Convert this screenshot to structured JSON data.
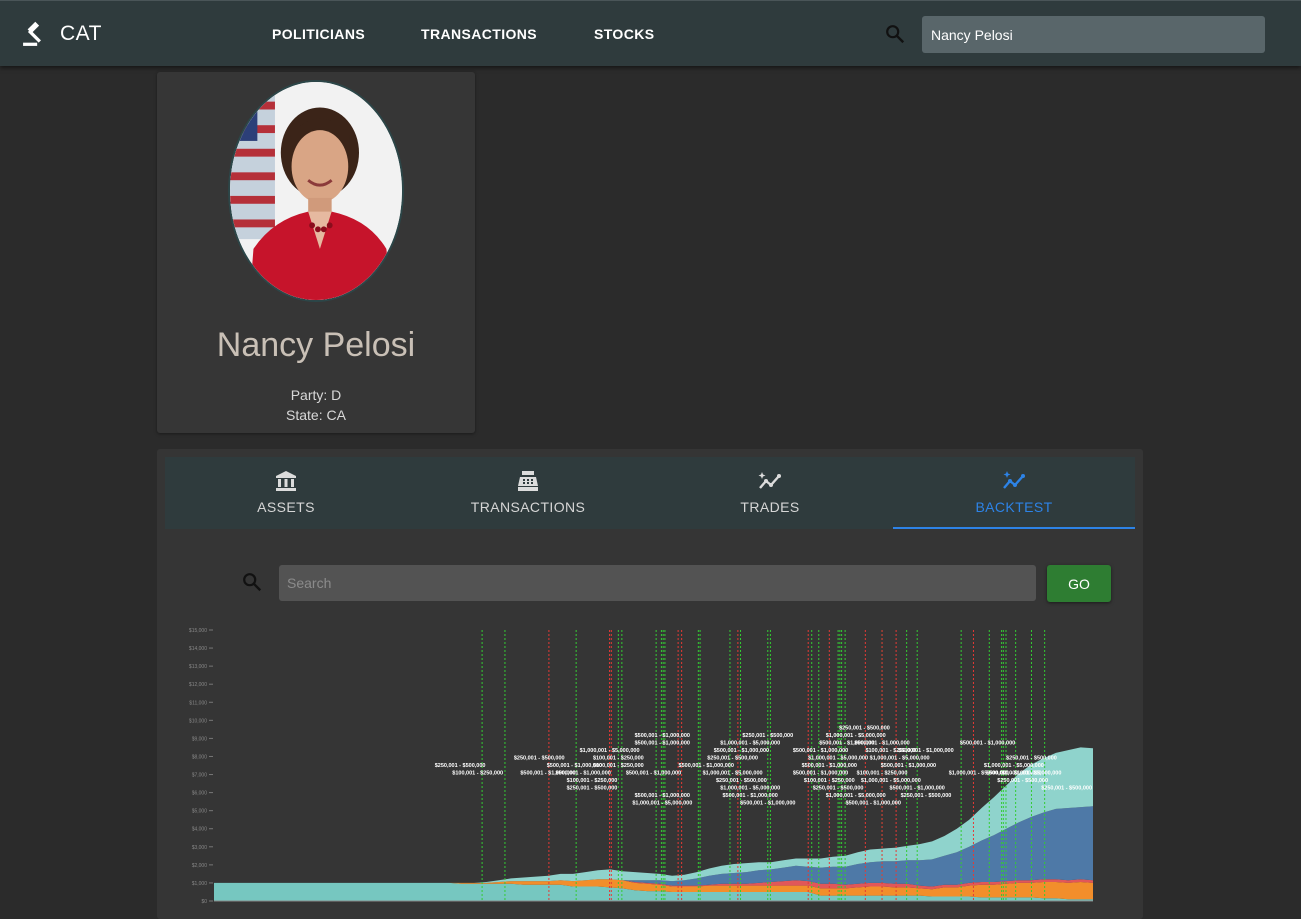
{
  "app": {
    "title": "CAT"
  },
  "nav": {
    "politicians": "POLITICIANS",
    "transactions": "TRANSACTIONS",
    "stocks": "STOCKS"
  },
  "search": {
    "value": "Nancy Pelosi"
  },
  "politician": {
    "name": "Nancy Pelosi",
    "party": "Party: D",
    "state": "State: CA"
  },
  "tabs": [
    {
      "label": "ASSETS",
      "icon": "bank-icon"
    },
    {
      "label": "TRANSACTIONS",
      "icon": "cash-register-icon"
    },
    {
      "label": "TRADES",
      "icon": "chart-line-icon"
    },
    {
      "label": "BACKTEST",
      "icon": "chart-sparkle-icon",
      "active": true
    }
  ],
  "backtest": {
    "search_placeholder": "Search",
    "go_label": "GO"
  },
  "colors": {
    "accent": "#2d83e6",
    "go": "#2e7d32",
    "teal": "#76c7c0",
    "orange": "#f28e2b",
    "red": "#e15759",
    "blue": "#4e79a7",
    "buy_line": "#33cc33",
    "sell_line": "#e53935"
  },
  "chart_data": {
    "type": "area",
    "stacked": true,
    "series": [
      {
        "color": "#76c7c0",
        "values": [
          1000,
          1000,
          1000,
          1000,
          1000,
          1000,
          1000,
          1000,
          1000,
          1000,
          1000,
          1000,
          1000,
          1000,
          1000,
          1000,
          1000,
          1000,
          1000,
          1000,
          950,
          950,
          950,
          950,
          950,
          900,
          900,
          900,
          900,
          800,
          800,
          800,
          750,
          700,
          600,
          550,
          550,
          500,
          500,
          500,
          500,
          500,
          500,
          500,
          500,
          500,
          500,
          500,
          500,
          300,
          300,
          300,
          300,
          300,
          300,
          300,
          300,
          300,
          250,
          250,
          250,
          250,
          200,
          200,
          200,
          200,
          200,
          150,
          150,
          100,
          100,
          100
        ]
      },
      {
        "color": "#f28e2b",
        "values": [
          0,
          0,
          0,
          0,
          0,
          0,
          0,
          0,
          0,
          0,
          0,
          0,
          0,
          0,
          0,
          0,
          0,
          0,
          0,
          0,
          50,
          50,
          50,
          100,
          150,
          200,
          200,
          200,
          250,
          300,
          350,
          400,
          450,
          450,
          400,
          400,
          350,
          300,
          300,
          300,
          350,
          350,
          350,
          350,
          350,
          350,
          350,
          350,
          350,
          400,
          400,
          400,
          450,
          500,
          500,
          450,
          450,
          400,
          400,
          500,
          500,
          600,
          700,
          700,
          750,
          800,
          800,
          900,
          900,
          900,
          950,
          900
        ]
      },
      {
        "color": "#e15759",
        "values": [
          0,
          0,
          0,
          0,
          0,
          0,
          0,
          0,
          0,
          0,
          0,
          0,
          0,
          0,
          0,
          0,
          0,
          0,
          0,
          0,
          0,
          0,
          0,
          0,
          0,
          0,
          0,
          0,
          0,
          0,
          0,
          0,
          0,
          0,
          50,
          50,
          50,
          50,
          50,
          50,
          50,
          100,
          100,
          100,
          150,
          200,
          250,
          300,
          250,
          250,
          250,
          200,
          200,
          200,
          200,
          200,
          200,
          150,
          150,
          150,
          150,
          150,
          150,
          150,
          150,
          150,
          150,
          150,
          150,
          150,
          150,
          150
        ]
      },
      {
        "color": "#4e79a7",
        "values": [
          0,
          0,
          0,
          0,
          0,
          0,
          0,
          0,
          0,
          0,
          0,
          0,
          0,
          0,
          0,
          0,
          0,
          0,
          0,
          0,
          0,
          0,
          0,
          0,
          0,
          0,
          0,
          0,
          0,
          0,
          0,
          0,
          0,
          0,
          100,
          150,
          200,
          250,
          300,
          400,
          500,
          550,
          600,
          650,
          700,
          700,
          750,
          800,
          800,
          900,
          950,
          1000,
          1100,
          1150,
          1200,
          1250,
          1300,
          1400,
          1500,
          1600,
          1800,
          2000,
          2300,
          2600,
          2900,
          3200,
          3500,
          3700,
          3900,
          4000,
          4000,
          4100
        ]
      },
      {
        "color": "#8fd3cc",
        "values": [
          0,
          0,
          0,
          0,
          0,
          0,
          0,
          0,
          0,
          0,
          0,
          0,
          0,
          0,
          0,
          0,
          0,
          0,
          0,
          0,
          0,
          0,
          50,
          100,
          150,
          200,
          250,
          300,
          350,
          400,
          450,
          500,
          550,
          500,
          450,
          400,
          350,
          300,
          300,
          350,
          400,
          450,
          500,
          500,
          450,
          400,
          400,
          400,
          450,
          500,
          550,
          600,
          650,
          700,
          700,
          750,
          800,
          900,
          1000,
          1100,
          1300,
          1500,
          1800,
          2100,
          2400,
          2700,
          2900,
          3000,
          3100,
          3200,
          3300,
          3200
        ]
      }
    ],
    "y_ticks": [
      "$0",
      "$1,000",
      "$2,000",
      "$3,000",
      "$4,000",
      "$5,000",
      "$6,000",
      "$7,000",
      "$8,000",
      "$9,000",
      "$10,000",
      "$11,000",
      "$12,000",
      "$13,000",
      "$14,000",
      "$15,000"
    ],
    "ylim": [
      0,
      15000
    ],
    "buy_lines": [
      0.305,
      0.331,
      0.412,
      0.46,
      0.464,
      0.503,
      0.509,
      0.511,
      0.513,
      0.551,
      0.553,
      0.587,
      0.599,
      0.63,
      0.633,
      0.68,
      0.688,
      0.71,
      0.712,
      0.714,
      0.718,
      0.76,
      0.788,
      0.8,
      0.85,
      0.882,
      0.896,
      0.898,
      0.901,
      0.912,
      0.93,
      0.945
    ],
    "sell_lines": [
      0.381,
      0.45,
      0.452,
      0.528,
      0.532,
      0.596,
      0.676,
      0.7,
      0.741,
      0.76,
      0.776,
      0.864
    ],
    "annotations": [
      {
        "text": "$500,001 - $1,000,000",
        "x": 0.51,
        "row": 0
      },
      {
        "text": "$500,001 - $1,000,000",
        "x": 0.51,
        "row": 1
      },
      {
        "text": "$1,000,001 - $5,000,000",
        "x": 0.45,
        "row": 2
      },
      {
        "text": "$250,001 - $500,000",
        "x": 0.37,
        "row": 3
      },
      {
        "text": "$100,001 - $250,000",
        "x": 0.46,
        "row": 3
      },
      {
        "text": "$500,001 - $1,000,000",
        "x": 0.41,
        "row": 4
      },
      {
        "text": "$100,001 - $250,000",
        "x": 0.46,
        "row": 4
      },
      {
        "text": "$250,001 - $500,000",
        "x": 0.28,
        "row": 4
      },
      {
        "text": "$100,001 - $250,000",
        "x": 0.3,
        "row": 5
      },
      {
        "text": "$500,001 - $1,000,000",
        "x": 0.38,
        "row": 5
      },
      {
        "text": "$500,001 - $1,000,000",
        "x": 0.42,
        "row": 5
      },
      {
        "text": "$500,001 - $1,000,000",
        "x": 0.5,
        "row": 5
      },
      {
        "text": "$100,001 - $250,000",
        "x": 0.43,
        "row": 6
      },
      {
        "text": "$250,001 - $500,000",
        "x": 0.43,
        "row": 7
      },
      {
        "text": "$500,001 - $1,000,000",
        "x": 0.51,
        "row": 8
      },
      {
        "text": "$1,000,001 - $5,000,000",
        "x": 0.51,
        "row": 9
      },
      {
        "text": "$250,001 - $500,000",
        "x": 0.63,
        "row": 0
      },
      {
        "text": "$1,000,001 - $5,000,000",
        "x": 0.61,
        "row": 1
      },
      {
        "text": "$500,001 - $1,000,000",
        "x": 0.6,
        "row": 2
      },
      {
        "text": "$250,001 - $500,000",
        "x": 0.59,
        "row": 3
      },
      {
        "text": "$500,001 - $1,000,000",
        "x": 0.56,
        "row": 4
      },
      {
        "text": "$1,000,001 - $5,000,000",
        "x": 0.59,
        "row": 5
      },
      {
        "text": "$250,001 - $500,000",
        "x": 0.6,
        "row": 6
      },
      {
        "text": "$1,000,001 - $5,000,000",
        "x": 0.61,
        "row": 7
      },
      {
        "text": "$500,001 - $1,000,000",
        "x": 0.61,
        "row": 8
      },
      {
        "text": "$500,001 - $1,000,000",
        "x": 0.63,
        "row": 9
      },
      {
        "text": "$250,001 - $500,000",
        "x": 0.74,
        "row": -1
      },
      {
        "text": "$1,000,001 - $5,000,000",
        "x": 0.73,
        "row": 0
      },
      {
        "text": "$500,001 - $1,000,000",
        "x": 0.72,
        "row": 1
      },
      {
        "text": "$500,001 - $1,000,000",
        "x": 0.69,
        "row": 2
      },
      {
        "text": "$100,001 - $250,000",
        "x": 0.77,
        "row": 2
      },
      {
        "text": "$1,000,001 - $5,000,000",
        "x": 0.71,
        "row": 3
      },
      {
        "text": "$1,000,001 - $5,000,000",
        "x": 0.78,
        "row": 3
      },
      {
        "text": "$500,001 - $1,000,000",
        "x": 0.7,
        "row": 4
      },
      {
        "text": "$500,001 - $1,000,000",
        "x": 0.79,
        "row": 4
      },
      {
        "text": "$500,001 - $1,000,000",
        "x": 0.69,
        "row": 5
      },
      {
        "text": "$100,001 - $250,000",
        "x": 0.76,
        "row": 5
      },
      {
        "text": "$100,001 - $250,000",
        "x": 0.7,
        "row": 6
      },
      {
        "text": "$1,000,001 - $5,000,000",
        "x": 0.77,
        "row": 6
      },
      {
        "text": "$250,001 - $500,000",
        "x": 0.71,
        "row": 7
      },
      {
        "text": "$500,001 - $1,000,000",
        "x": 0.8,
        "row": 7
      },
      {
        "text": "$1,000,001 - $5,000,000",
        "x": 0.73,
        "row": 8
      },
      {
        "text": "$250,001 - $500,000",
        "x": 0.81,
        "row": 8
      },
      {
        "text": "$500,001 - $1,000,000",
        "x": 0.75,
        "row": 9
      },
      {
        "text": "$500,001 - $1,000,000",
        "x": 0.76,
        "row": 1
      },
      {
        "text": "$500,001 - $1,000,000",
        "x": 0.81,
        "row": 2
      },
      {
        "text": "$1,000,001 - $5,000,000",
        "x": 0.87,
        "row": 5
      },
      {
        "text": "$500,001 - $1,000,000",
        "x": 0.91,
        "row": 5
      },
      {
        "text": "$1,000,001 - $5,000,000",
        "x": 0.91,
        "row": 4
      },
      {
        "text": "$250,001 - $500,000",
        "x": 0.92,
        "row": 6
      },
      {
        "text": "$1,000,001 - $5,000,000",
        "x": 0.93,
        "row": 5
      },
      {
        "text": "$250,001 - $500,000",
        "x": 0.93,
        "row": 3
      },
      {
        "text": "$250,001 - $500,000",
        "x": 0.97,
        "row": 7
      },
      {
        "text": "$500,001 - $1,000,000",
        "x": 0.88,
        "row": 1
      }
    ]
  }
}
